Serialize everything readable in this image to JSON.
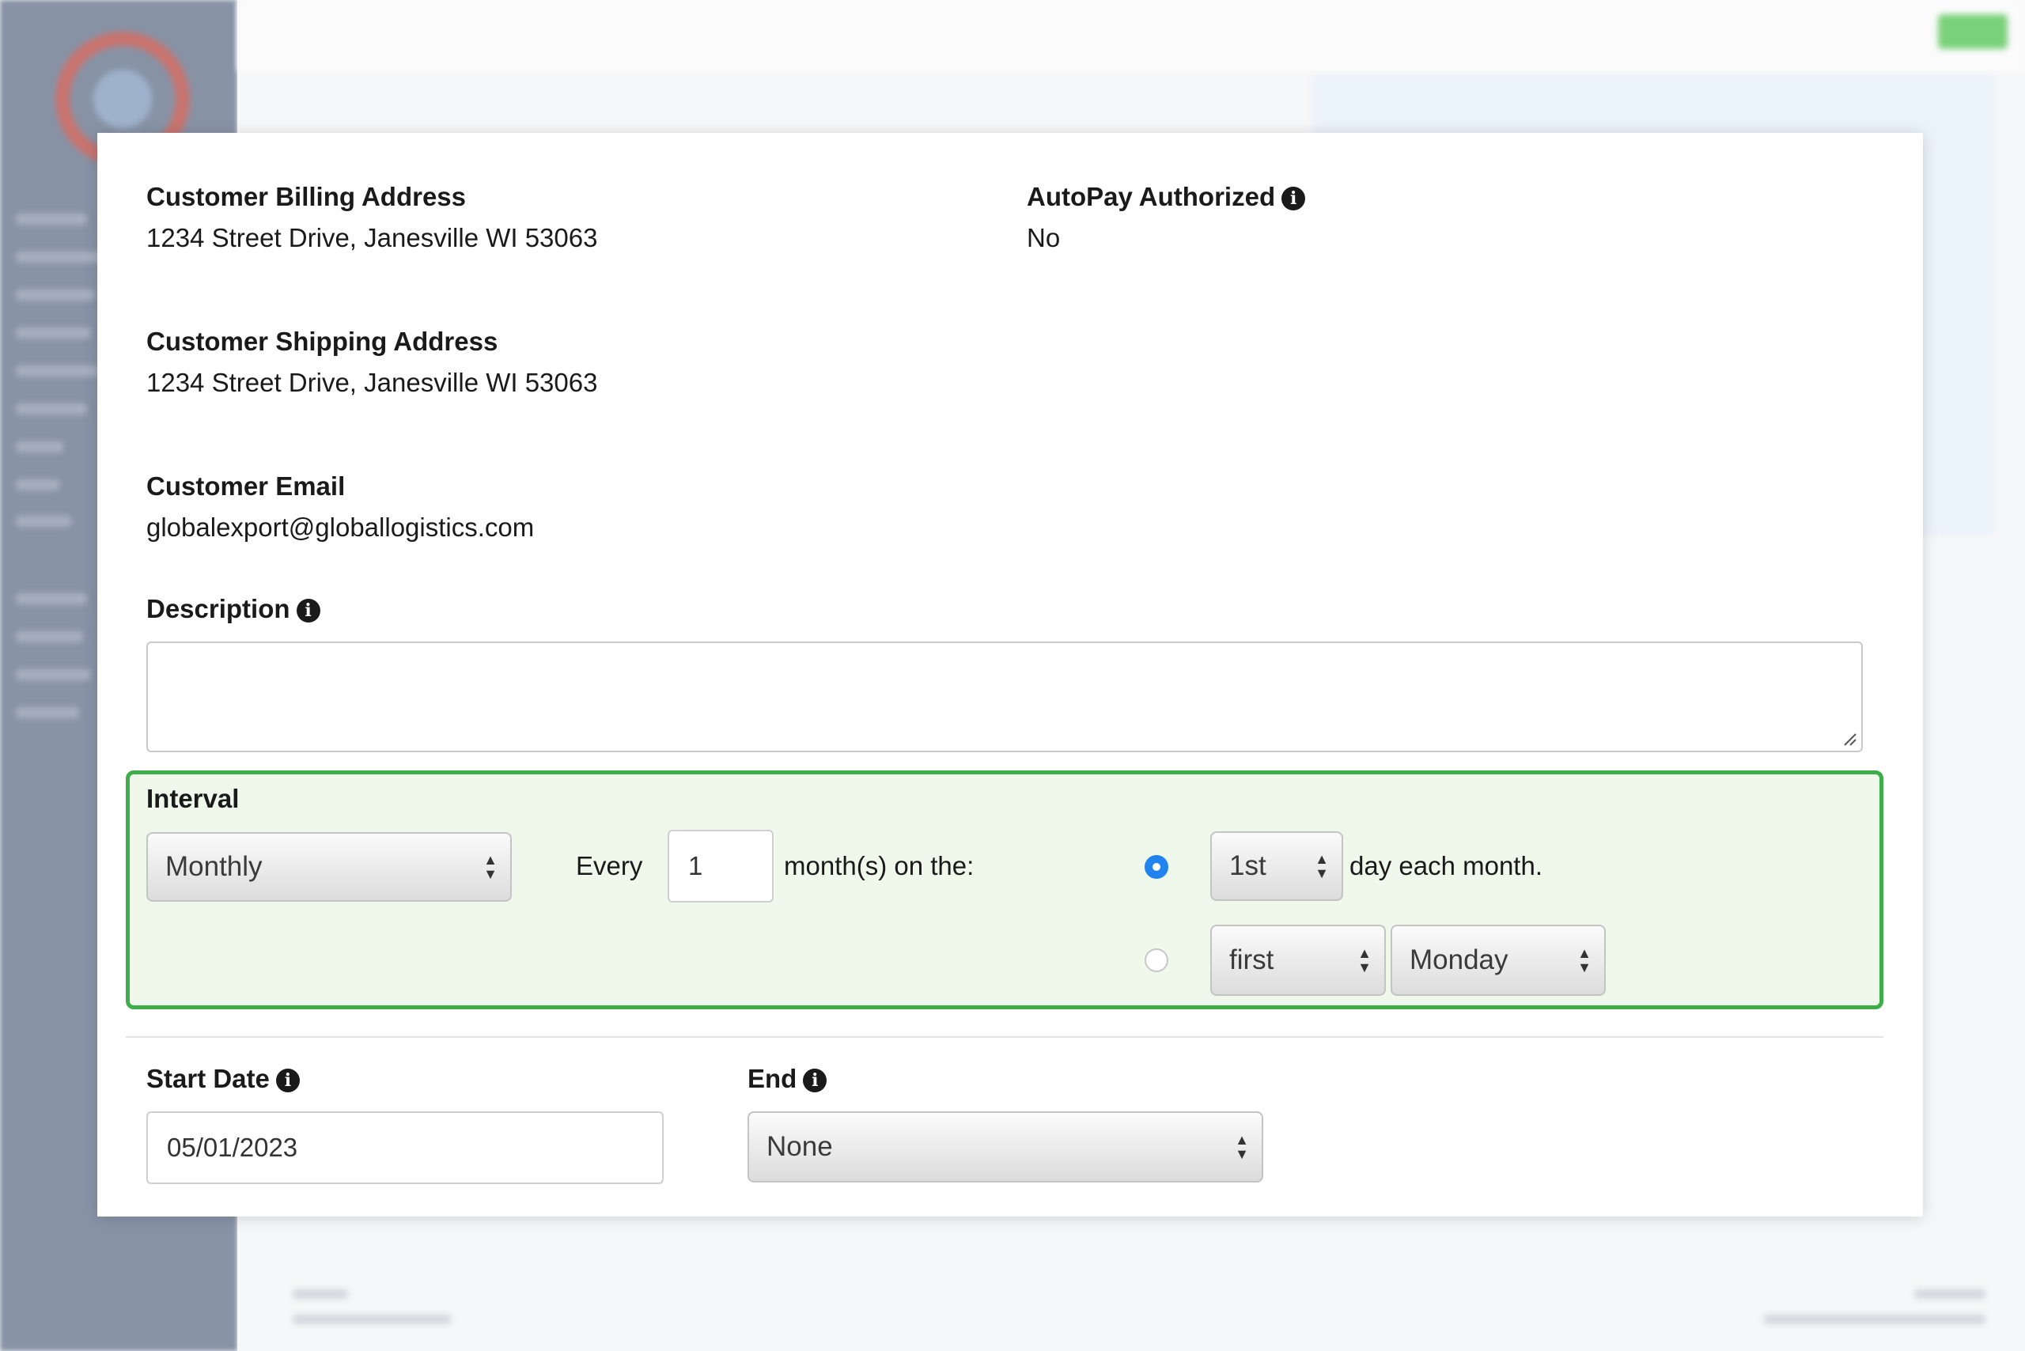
{
  "billing": {
    "label": "Customer Billing Address",
    "value": "1234 Street Drive, Janesville WI 53063"
  },
  "autopay": {
    "label": "AutoPay Authorized",
    "value": "No"
  },
  "shipping": {
    "label": "Customer Shipping Address",
    "value": "1234 Street Drive, Janesville WI 53063"
  },
  "email": {
    "label": "Customer Email",
    "value": "globalexport@globallogistics.com"
  },
  "description": {
    "label": "Description",
    "value": ""
  },
  "interval": {
    "label": "Interval",
    "frequency": "Monthly",
    "every_label": "Every",
    "every_value": "1",
    "months_label": "month(s) on the:",
    "option1": {
      "selected": true,
      "day": "1st",
      "suffix": "day each month."
    },
    "option2": {
      "selected": false,
      "ordinal": "first",
      "weekday": "Monday"
    }
  },
  "start_date": {
    "label": "Start Date",
    "value": "05/01/2023"
  },
  "end": {
    "label": "End",
    "value": "None"
  },
  "colors": {
    "interval_border": "#3fae4a",
    "interval_bg": "#eff8ea",
    "radio_selected": "#1f84f0"
  },
  "icons": {
    "info": "info-circle-icon",
    "select": "sort-arrows-icon",
    "resize": "resize-grip-icon"
  }
}
